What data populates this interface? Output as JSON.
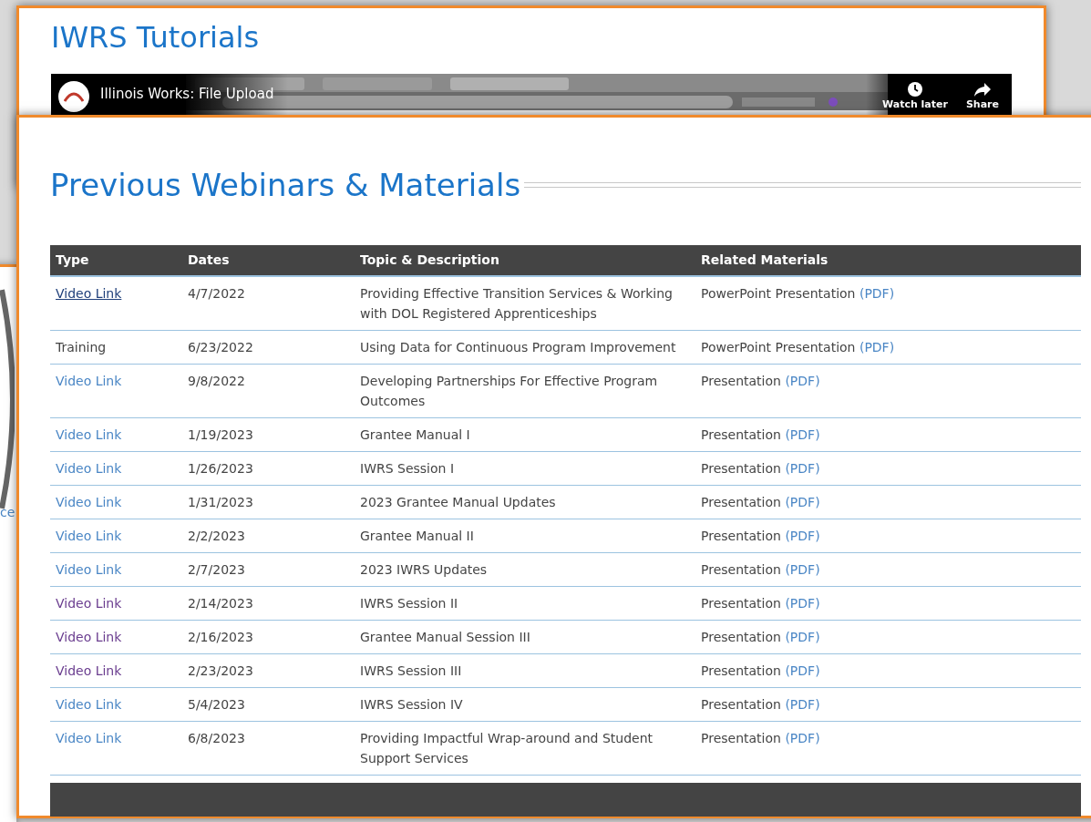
{
  "back_panel": {
    "title": "IWRS Tutorials",
    "video": {
      "title": "Illinois Works: File Upload",
      "actions": [
        "Watch later",
        "Share"
      ]
    }
  },
  "side_panel": {
    "text": "ce"
  },
  "section": {
    "title": "Previous Webinars & Materials"
  },
  "table": {
    "columns": [
      "Type",
      "Dates",
      "Topic & Description",
      "Related Materials"
    ],
    "rows": [
      {
        "type": {
          "text": "Video Link",
          "kind": "link",
          "visited": false,
          "hovered": true
        },
        "date": "4/7/2022",
        "topic": "Providing Effective Transition Services & Working with DOL Registered Apprenticeships",
        "material": "PowerPoint Presentation",
        "pdf": "(PDF)"
      },
      {
        "type": {
          "text": "Training",
          "kind": "text"
        },
        "date": "6/23/2022",
        "topic": "Using Data for Continuous Program Improvement",
        "material": "PowerPoint Presentation",
        "pdf": "(PDF)"
      },
      {
        "type": {
          "text": "Video Link",
          "kind": "link",
          "visited": false,
          "hovered": false
        },
        "date": "9/8/2022",
        "topic": "Developing Partnerships For Effective Program Outcomes",
        "material": "Presentation",
        "pdf": "(PDF)"
      },
      {
        "type": {
          "text": "Video Link",
          "kind": "link",
          "visited": false,
          "hovered": false
        },
        "date": "1/19/2023",
        "topic": "Grantee Manual I",
        "material": "Presentation",
        "pdf": "(PDF)"
      },
      {
        "type": {
          "text": "Video Link",
          "kind": "link",
          "visited": false,
          "hovered": false
        },
        "date": "1/26/2023",
        "topic": "IWRS Session I",
        "material": "Presentation",
        "pdf": "(PDF)"
      },
      {
        "type": {
          "text": "Video Link",
          "kind": "link",
          "visited": false,
          "hovered": false
        },
        "date": "1/31/2023",
        "topic": "2023 Grantee Manual Updates",
        "material": "Presentation",
        "pdf": "(PDF)"
      },
      {
        "type": {
          "text": "Video Link",
          "kind": "link",
          "visited": false,
          "hovered": false
        },
        "date": "2/2/2023",
        "topic": "Grantee Manual II",
        "material": "Presentation",
        "pdf": "(PDF)"
      },
      {
        "type": {
          "text": "Video Link",
          "kind": "link",
          "visited": false,
          "hovered": false
        },
        "date": "2/7/2023",
        "topic": "2023 IWRS Updates",
        "material": "Presentation",
        "pdf": "(PDF)"
      },
      {
        "type": {
          "text": "Video Link",
          "kind": "link",
          "visited": true,
          "hovered": false
        },
        "date": "2/14/2023",
        "topic": "IWRS Session II",
        "material": "Presentation",
        "pdf": "(PDF)"
      },
      {
        "type": {
          "text": "Video Link",
          "kind": "link",
          "visited": true,
          "hovered": false
        },
        "date": "2/16/2023",
        "topic": "Grantee Manual Session III",
        "material": "Presentation",
        "pdf": "(PDF)"
      },
      {
        "type": {
          "text": "Video Link",
          "kind": "link",
          "visited": true,
          "hovered": false
        },
        "date": "2/23/2023",
        "topic": "IWRS Session III",
        "material": "Presentation",
        "pdf": "(PDF)"
      },
      {
        "type": {
          "text": "Video Link",
          "kind": "link",
          "visited": false,
          "hovered": false
        },
        "date": "5/4/2023",
        "topic": "IWRS Session IV",
        "material": "Presentation",
        "pdf": "(PDF)"
      },
      {
        "type": {
          "text": "Video Link",
          "kind": "link",
          "visited": false,
          "hovered": false
        },
        "date": "6/8/2023",
        "topic": "Providing Impactful Wrap-around and Student Support Services",
        "material": "Presentation",
        "pdf": "(PDF)"
      }
    ]
  }
}
